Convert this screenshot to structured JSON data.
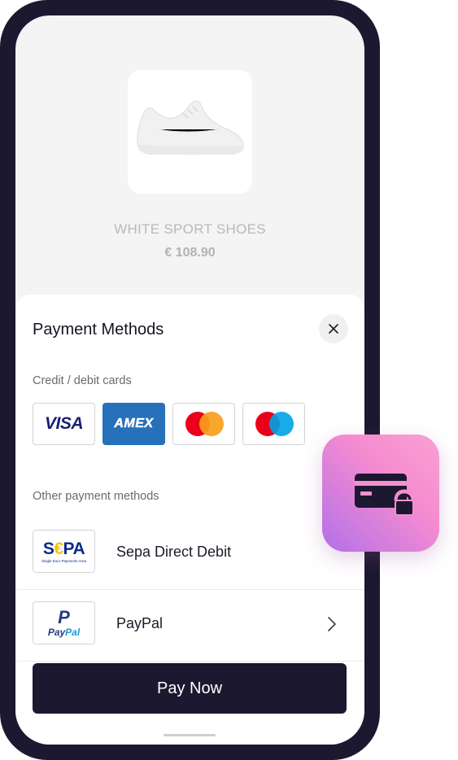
{
  "product": {
    "name": "WHITE SPORT SHOES",
    "price": "€ 108.90"
  },
  "sheet": {
    "title": "Payment Methods",
    "cards_section_label": "Credit / debit cards",
    "card_options": [
      {
        "name": "VISA",
        "icon": "visa-logo"
      },
      {
        "name": "AMEX",
        "icon": "amex-logo"
      },
      {
        "name": "Mastercard",
        "icon": "mastercard-logo"
      },
      {
        "name": "Maestro",
        "icon": "maestro-logo"
      }
    ],
    "other_section_label": "Other payment methods",
    "methods": [
      {
        "name": "Sepa Direct Debit",
        "logo_text": "SEPA",
        "logo_subtext": "Single Euro Payments Area"
      },
      {
        "name": "PayPal",
        "logo_text": "PayPal",
        "logo_mark": "P"
      }
    ],
    "pay_button": "Pay Now"
  },
  "colors": {
    "primary": "#1c1830",
    "amex_blue": "#2671b9",
    "visa_blue": "#1a1f71",
    "mastercard_red": "#eb001b",
    "mastercard_orange": "#f79e1b",
    "maestro_blue": "#00a2e5",
    "badge_gradient": [
      "#f9a1d2",
      "#b16fe5"
    ]
  },
  "icons": {
    "close": "close-icon",
    "chevron": "chevron-right-icon",
    "badge": "credit-card-lock-icon"
  }
}
